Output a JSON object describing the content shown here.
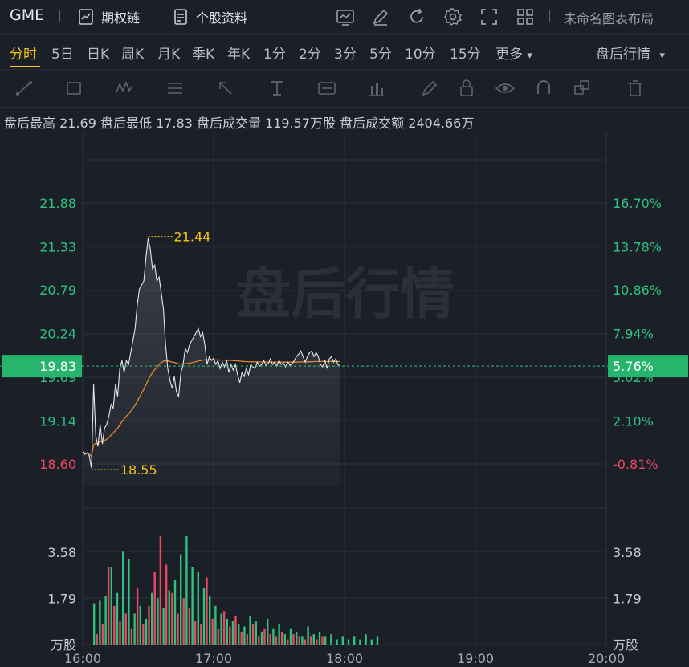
{
  "topbar": {
    "ticker": "GME",
    "options_chain": "期权链",
    "stock_info": "个股资料",
    "layout_name": "未命名图表布局"
  },
  "periods": {
    "items": [
      "分时",
      "5日",
      "日K",
      "周K",
      "月K",
      "季K",
      "年K",
      "1分",
      "2分",
      "3分",
      "5分",
      "10分",
      "15分",
      "更多"
    ],
    "active": "分时",
    "more_caret": "▾",
    "session": "盘后行情",
    "session_caret": "▾"
  },
  "stats": {
    "text": "盘后最高 21.69 盘后最低 17.83 盘后成交量 119.57万股 盘后成交额 2404.66万"
  },
  "chart_data": {
    "type": "line",
    "watermark": "盘后行情",
    "x_ticks": [
      "16:00",
      "17:00",
      "18:00",
      "19:00",
      "20:00"
    ],
    "price_ticks": [
      "21.88",
      "21.33",
      "20.79",
      "20.24",
      "19.69",
      "19.14",
      "18.60"
    ],
    "pct_ticks": [
      "16.70%",
      "13.78%",
      "10.86%",
      "7.94%",
      "5.02%",
      "2.10%",
      "-0.81%"
    ],
    "current_price": "19.83",
    "current_pct": "5.76%",
    "high_label": "21.44",
    "low_label": "18.55",
    "vol_ticks": [
      "3.58",
      "1.79"
    ],
    "vol_unit": "万股",
    "colors": {
      "up": "#2ec27e",
      "down": "#e84a5f",
      "avg": "#e08a2e",
      "price": "#e6e6e6",
      "label": "#f5c518"
    },
    "price_series": [
      [
        "16:00",
        18.75
      ],
      [
        "16:01",
        18.72
      ],
      [
        "16:02",
        18.74
      ],
      [
        "16:03",
        18.7
      ],
      [
        "16:04",
        18.55
      ],
      [
        "16:05",
        19.6
      ],
      [
        "16:06",
        18.95
      ],
      [
        "16:07",
        18.82
      ],
      [
        "16:08",
        19.1
      ],
      [
        "16:09",
        18.85
      ],
      [
        "16:10",
        19.05
      ],
      [
        "16:11",
        19.1
      ],
      [
        "16:12",
        19.2
      ],
      [
        "16:13",
        19.35
      ],
      [
        "16:14",
        19.3
      ],
      [
        "16:15",
        19.6
      ],
      [
        "16:16",
        19.45
      ],
      [
        "16:17",
        19.8
      ],
      [
        "16:18",
        19.9
      ],
      [
        "16:19",
        19.75
      ],
      [
        "16:20",
        19.9
      ],
      [
        "16:21",
        19.85
      ],
      [
        "16:22",
        20.0
      ],
      [
        "16:23",
        20.15
      ],
      [
        "16:24",
        20.3
      ],
      [
        "16:25",
        20.6
      ],
      [
        "16:26",
        20.8
      ],
      [
        "16:27",
        20.85
      ],
      [
        "16:28",
        20.9
      ],
      [
        "16:29",
        21.2
      ],
      [
        "16:30",
        21.44
      ],
      [
        "16:31",
        21.3
      ],
      [
        "16:32",
        21.05
      ],
      [
        "16:33",
        21.1
      ],
      [
        "16:34",
        20.9
      ],
      [
        "16:35",
        20.95
      ],
      [
        "16:36",
        20.75
      ],
      [
        "16:37",
        20.55
      ],
      [
        "16:38",
        20.1
      ],
      [
        "16:39",
        19.8
      ],
      [
        "16:40",
        19.65
      ],
      [
        "16:41",
        19.55
      ],
      [
        "16:42",
        19.7
      ],
      [
        "16:43",
        19.5
      ],
      [
        "16:44",
        19.45
      ],
      [
        "16:45",
        19.75
      ],
      [
        "16:46",
        19.85
      ],
      [
        "16:47",
        20.05
      ],
      [
        "16:48",
        20.0
      ],
      [
        "16:49",
        20.1
      ],
      [
        "16:50",
        20.15
      ],
      [
        "16:51",
        20.2
      ],
      [
        "16:52",
        20.25
      ],
      [
        "16:53",
        20.3
      ],
      [
        "16:54",
        20.2
      ],
      [
        "16:55",
        20.25
      ],
      [
        "16:56",
        20.1
      ],
      [
        "16:57",
        19.85
      ],
      [
        "16:58",
        19.95
      ],
      [
        "16:59",
        19.9
      ],
      [
        "17:00",
        19.93
      ],
      [
        "17:01",
        19.85
      ],
      [
        "17:02",
        19.9
      ],
      [
        "17:03",
        19.8
      ],
      [
        "17:04",
        19.88
      ],
      [
        "17:05",
        19.82
      ],
      [
        "17:06",
        19.9
      ],
      [
        "17:07",
        19.75
      ],
      [
        "17:08",
        19.85
      ],
      [
        "17:09",
        19.78
      ],
      [
        "17:10",
        19.85
      ],
      [
        "17:11",
        19.72
      ],
      [
        "17:12",
        19.62
      ],
      [
        "17:13",
        19.75
      ],
      [
        "17:14",
        19.7
      ],
      [
        "17:15",
        19.8
      ],
      [
        "17:16",
        19.72
      ],
      [
        "17:17",
        19.85
      ],
      [
        "17:18",
        19.82
      ],
      [
        "17:19",
        19.8
      ],
      [
        "17:20",
        19.88
      ],
      [
        "17:21",
        19.83
      ],
      [
        "17:22",
        19.85
      ],
      [
        "17:23",
        19.9
      ],
      [
        "17:24",
        19.84
      ],
      [
        "17:25",
        19.86
      ],
      [
        "17:26",
        19.92
      ],
      [
        "17:27",
        19.85
      ],
      [
        "17:28",
        19.88
      ],
      [
        "17:29",
        19.83
      ],
      [
        "17:30",
        19.9
      ],
      [
        "17:31",
        19.85
      ],
      [
        "17:32",
        19.87
      ],
      [
        "17:33",
        19.82
      ],
      [
        "17:34",
        19.88
      ],
      [
        "17:35",
        19.84
      ],
      [
        "17:36",
        19.86
      ],
      [
        "17:37",
        19.9
      ],
      [
        "17:38",
        19.95
      ],
      [
        "17:39",
        19.98
      ],
      [
        "17:40",
        20.02
      ],
      [
        "17:41",
        19.95
      ],
      [
        "17:42",
        19.88
      ],
      [
        "17:43",
        19.95
      ],
      [
        "17:44",
        20.0
      ],
      [
        "17:45",
        20.02
      ],
      [
        "17:46",
        19.95
      ],
      [
        "17:47",
        20.0
      ],
      [
        "17:48",
        19.95
      ],
      [
        "17:49",
        19.85
      ],
      [
        "17:50",
        19.82
      ],
      [
        "17:51",
        19.9
      ],
      [
        "17:52",
        19.8
      ],
      [
        "17:53",
        19.92
      ],
      [
        "17:54",
        19.95
      ],
      [
        "17:55",
        19.88
      ],
      [
        "17:56",
        19.92
      ],
      [
        "17:57",
        19.85
      ],
      [
        "17:58",
        19.83
      ]
    ],
    "avg_series_note": "",
    "volume_bars_up": [
      1.6,
      1.7,
      1.9,
      3.0,
      2.0,
      3.6,
      3.3,
      1.2,
      1.5,
      1.0,
      2.0,
      1.8,
      1.4,
      2.1,
      2.5,
      3.5,
      4.2,
      3.0,
      2.8,
      2.2,
      1.9,
      1.5,
      1.2,
      1.0,
      0.9,
      0.8,
      0.7,
      1.1,
      0.9,
      0.5,
      1.0,
      0.6,
      0.8,
      0.4,
      0.6,
      0.5,
      0.3,
      0.7,
      0.4,
      0.5,
      0.3,
      0.4,
      0.2,
      0.3,
      0.2,
      0.3,
      0.2,
      0.4,
      0.2,
      0.3
    ],
    "volume_bars_down": [
      0.4,
      0.8,
      3.0,
      1.5,
      0.9,
      1.2,
      0.6,
      2.2,
      0.8,
      1.5,
      2.8,
      4.2,
      3.1,
      2.0,
      1.2,
      1.8,
      1.4,
      0.9,
      0.8,
      2.6,
      1.0,
      0.6,
      1.3,
      0.7,
      1.1,
      0.5,
      0.4,
      0.8,
      0.3,
      0.6,
      0.4,
      0.3,
      0.5,
      0.2,
      0.4,
      0.3,
      0.2,
      0.3,
      0.2,
      0.3
    ]
  }
}
